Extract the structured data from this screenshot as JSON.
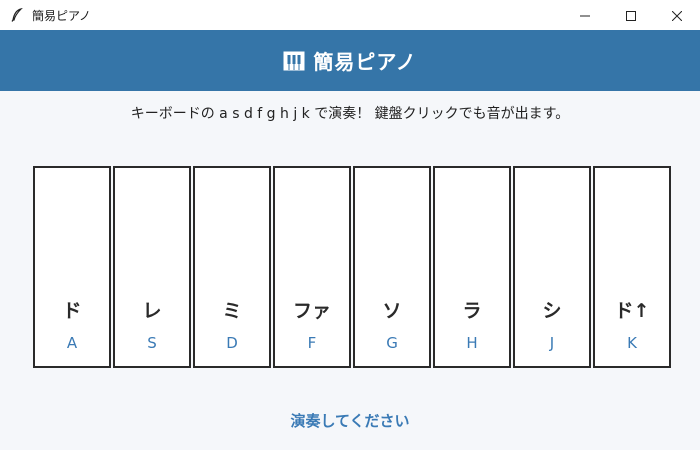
{
  "window": {
    "title": "簡易ピアノ",
    "icon": "feather-icon",
    "controls": [
      "minimize-icon",
      "maximize-icon",
      "close-icon"
    ]
  },
  "header": {
    "icon": "piano-icon",
    "title": "簡易ピアノ"
  },
  "instruction": "キーボードの a s d f g h j k で演奏！ 鍵盤クリックでも音が出ます。",
  "keys": [
    {
      "note": "ド",
      "key": "A"
    },
    {
      "note": "レ",
      "key": "S"
    },
    {
      "note": "ミ",
      "key": "D"
    },
    {
      "note": "ファ",
      "key": "F"
    },
    {
      "note": "ソ",
      "key": "G"
    },
    {
      "note": "ラ",
      "key": "H"
    },
    {
      "note": "シ",
      "key": "J"
    },
    {
      "note": "ド↑",
      "key": "K"
    }
  ],
  "status": "演奏してください",
  "colors": {
    "header_bg": "#3575a8",
    "accent": "#3a7ab5",
    "key_border": "#2a2a2a",
    "background": "#f5f7fa"
  }
}
